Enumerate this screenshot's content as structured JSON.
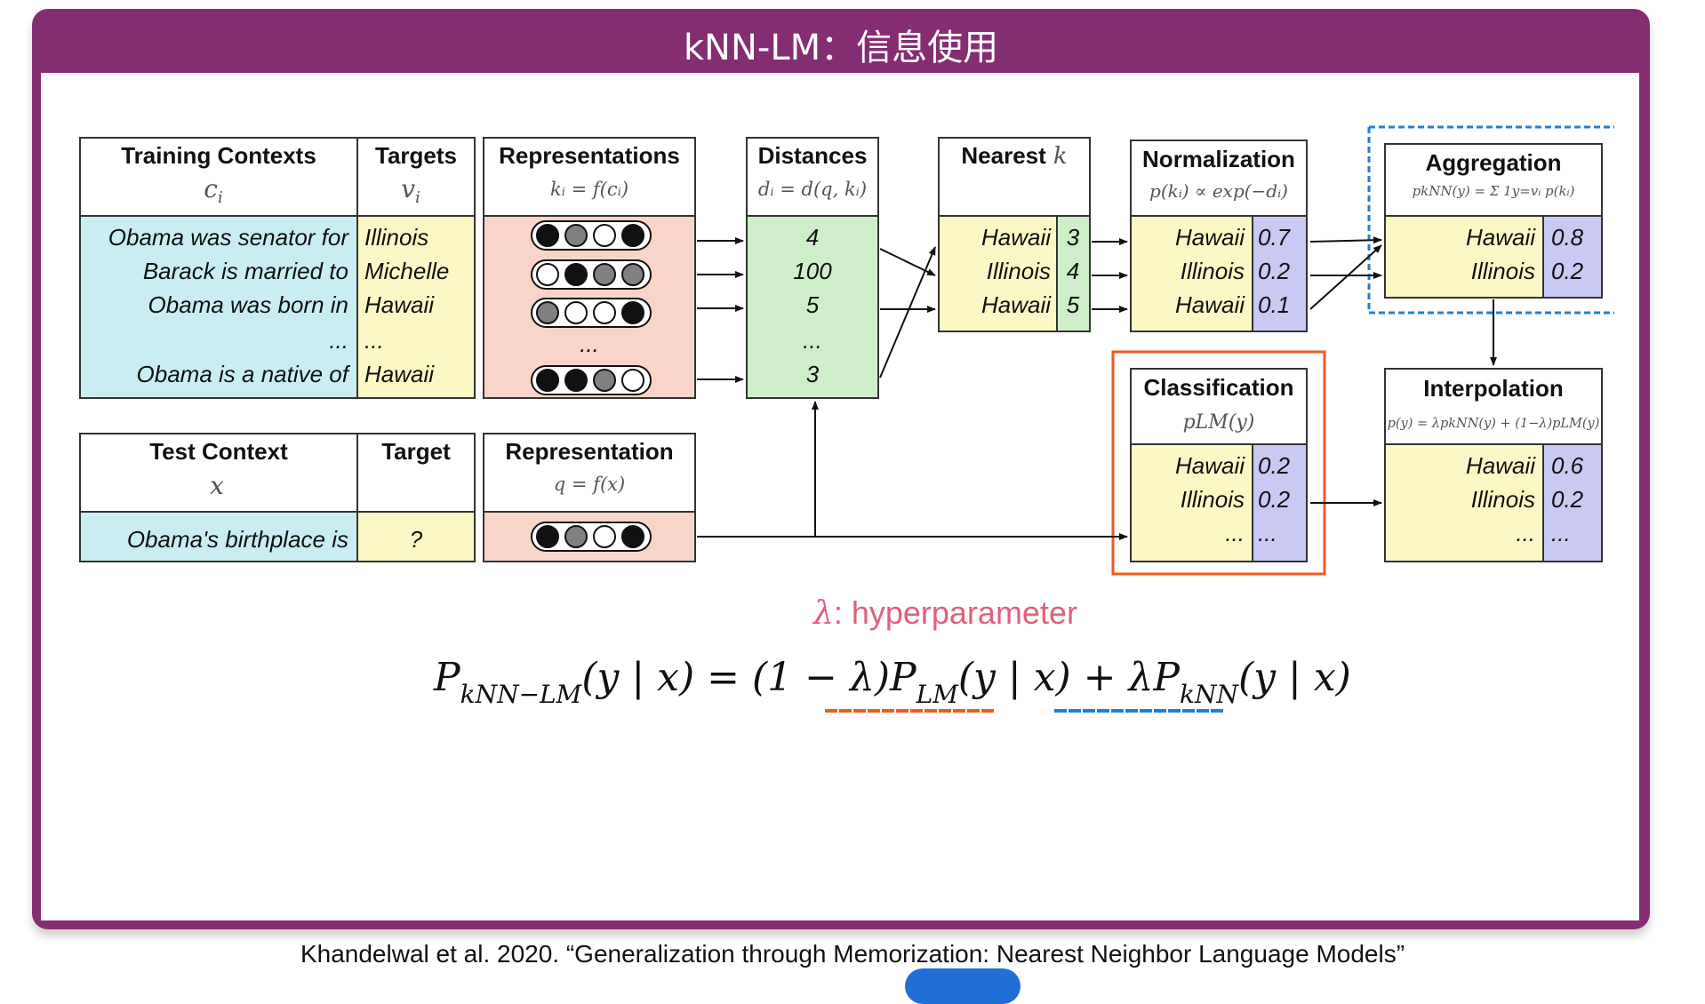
{
  "header": {
    "title": "kNN-LM：信息使用"
  },
  "training": {
    "contexts_header": "Training Contexts",
    "contexts_var": "c",
    "contexts_sub": "i",
    "targets_header": "Targets",
    "targets_var": "v",
    "targets_sub": "i",
    "rows": [
      {
        "context": "Obama was senator for",
        "target": "Illinois"
      },
      {
        "context": "Barack is married to",
        "target": "Michelle"
      },
      {
        "context": "Obama was born in",
        "target": "Hawaii"
      },
      {
        "context": "...",
        "target": "..."
      },
      {
        "context": "Obama is a native of",
        "target": "Hawaii"
      }
    ]
  },
  "representations": {
    "header": "Representations",
    "formula": "kᵢ = f(cᵢ)",
    "ellipsis": "...",
    "dots": [
      [
        "#111111",
        "#808080",
        "#ffffff",
        "#111111"
      ],
      [
        "#ffffff",
        "#111111",
        "#808080",
        "#808080"
      ],
      [
        "#808080",
        "#ffffff",
        "#ffffff",
        "#111111"
      ],
      [
        "#111111",
        "#111111",
        "#808080",
        "#ffffff"
      ]
    ]
  },
  "distances": {
    "header": "Distances",
    "formula": "dᵢ = d(q, kᵢ)",
    "values": [
      "4",
      "100",
      "5",
      "...",
      "3"
    ]
  },
  "nearest": {
    "header": "Nearest",
    "header_var": "k",
    "rows": [
      {
        "label": "Hawaii",
        "value": "3"
      },
      {
        "label": "Illinois",
        "value": "4"
      },
      {
        "label": "Hawaii",
        "value": "5"
      }
    ]
  },
  "normalization": {
    "header": "Normalization",
    "formula": "p(kᵢ) ∝ exp(−dᵢ)",
    "rows": [
      {
        "label": "Hawaii",
        "value": "0.7"
      },
      {
        "label": "Illinois",
        "value": "0.2"
      },
      {
        "label": "Hawaii",
        "value": "0.1"
      }
    ]
  },
  "aggregation": {
    "header": "Aggregation",
    "formula": "pkNN(y) = Σ 1y=vᵢ p(kᵢ)",
    "rows": [
      {
        "label": "Hawaii",
        "value": "0.8"
      },
      {
        "label": "Illinois",
        "value": "0.2"
      }
    ]
  },
  "test": {
    "context_header": "Test Context",
    "context_var": "x",
    "target_header": "Target",
    "context": "Obama's birthplace is",
    "target": "?"
  },
  "test_representation": {
    "header": "Representation",
    "formula": "q = f(x)",
    "dots": [
      "#111111",
      "#808080",
      "#ffffff",
      "#111111"
    ]
  },
  "classification": {
    "header": "Classification",
    "formula": "pLM(y)",
    "rows": [
      {
        "label": "Hawaii",
        "value": "0.2"
      },
      {
        "label": "Illinois",
        "value": "0.2"
      },
      {
        "label": "...",
        "value": "..."
      }
    ]
  },
  "interpolation": {
    "header": "Interpolation",
    "formula": "p(y) = λpkNN(y) + (1−λ)pLM(y)",
    "rows": [
      {
        "label": "Hawaii",
        "value": "0.6"
      },
      {
        "label": "Illinois",
        "value": "0.2"
      },
      {
        "label": "...",
        "value": "..."
      }
    ]
  },
  "hyperparameter": {
    "symbol": "λ",
    "text": ": hyperparameter"
  },
  "formula": {
    "p": "P",
    "sub_knnlm": "kNN−LM",
    "args1": "(y | x) = (1 − λ)",
    "sub_lm": "LM",
    "args2": "(y | x) + λ",
    "sub_knn": "kNN",
    "args3": "(y | x)"
  },
  "colors": {
    "accent": "#852d73",
    "context_fill": "#c8eef4",
    "target_fill": "#fcf8c5",
    "repr_fill": "#f9d4c8",
    "dist_fill": "#cdeec8",
    "value_fill": "#c9c9f4",
    "classification_box": "#ee5a22",
    "aggregation_box": "#1f7fd6",
    "hyperparameter": "#e0607a"
  },
  "citation": "Khandelwal et al. 2020. “Generalization through Memorization: Nearest Neighbor Language Models”"
}
